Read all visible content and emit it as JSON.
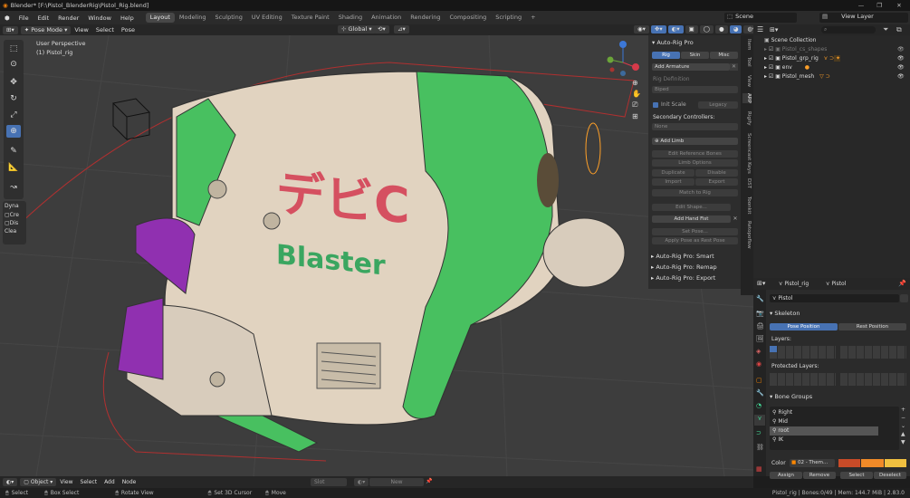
{
  "window": {
    "title": "Blender* [F:\\Pistol_BlenderRig\\Pistol_Rig.blend]",
    "controls": [
      "—",
      "❐",
      "✕"
    ]
  },
  "menubar": {
    "items": [
      "File",
      "Edit",
      "Render",
      "Window",
      "Help"
    ]
  },
  "workspaces": [
    "Layout",
    "Modeling",
    "Sculpting",
    "UV Editing",
    "Texture Paint",
    "Shading",
    "Animation",
    "Rendering",
    "Compositing",
    "Scripting",
    "+"
  ],
  "scene": {
    "label": "Scene",
    "view_layer": "View Layer"
  },
  "viewport_header": {
    "mode": "Pose Mode",
    "menus": [
      "View",
      "Select",
      "Pose"
    ],
    "transform": "Global"
  },
  "viewport": {
    "perspective": "User Perspective",
    "object": "(1) Pistol_rig",
    "logo_text": "Blaster",
    "logo_glyphs": "デビC"
  },
  "toolbar_dyn": {
    "title": "Dyna",
    "items": [
      "Cre",
      "Dis",
      "Clea"
    ]
  },
  "npanel": {
    "title": "Auto-Rig Pro",
    "tabs": [
      "Rig",
      "Skin",
      "Misc"
    ],
    "add_armature": "Add Armature",
    "rig_definition": "Rig Definition",
    "rig_definition_value": "Biped",
    "init_scale": "Init Scale",
    "legacy": "Legacy",
    "secondary": "Secondary Controllers:",
    "secondary_value": "None",
    "add_limb": "Add Limb",
    "edit_reference": "Edit Reference Bones",
    "limb_options": "Limb Options",
    "duplicate": "Duplicate",
    "disable": "Disable",
    "import": "Import",
    "export": "Export",
    "match_to_rig": "Match to Rig",
    "edit_shape": "Edit Shape...",
    "add_hand_fist": "Add Hand Fist",
    "set_pose": "Set Pose...",
    "apply_pose": "Apply Pose as Rest Pose",
    "sub_panels": [
      "Auto-Rig Pro: Smart",
      "Auto-Rig Pro: Remap",
      "Auto-Rig Pro: Export"
    ],
    "side_tabs": [
      "Item",
      "Tool",
      "View",
      "ARP",
      "Rigify",
      "Screencast Keys",
      "DST",
      "Toonkit",
      "Retopoflow"
    ]
  },
  "outliner": {
    "root": "Scene Collection",
    "items": [
      {
        "name": "Pistol_cs_shapes",
        "dim": true
      },
      {
        "name": "Pistol_grp_rig",
        "dim": false
      },
      {
        "name": "env",
        "dim": false
      },
      {
        "name": "Pistol_mesh",
        "dim": false
      }
    ]
  },
  "properties": {
    "armature": "Pistol_rig",
    "data": "Pistol",
    "data_field": "Pistol",
    "skeleton": "Skeleton",
    "pose_position": "Pose Position",
    "rest_position": "Rest Position",
    "layers": "Layers:",
    "protected_layers": "Protected Layers:",
    "bone_groups": "Bone Groups",
    "groups": [
      "Right",
      "Mid",
      "root",
      "IK"
    ],
    "selected_group": "root",
    "color_label": "Color",
    "color_set": "02 - Them...",
    "assign": "Assign",
    "remove": "Remove",
    "select": "Select",
    "deselect": "Deselect"
  },
  "timeline": {
    "mode": "Object",
    "menus": [
      "View",
      "Select",
      "Add",
      "Node"
    ],
    "slot": "Slot",
    "new": "New"
  },
  "status": {
    "left": [
      "Select",
      "Box Select",
      "Rotate View",
      "Set 3D Cursor",
      "Move"
    ],
    "right": "Pistol_rig | Bones:0/49 | Mem: 144.7 MiB | 2.83.0"
  },
  "colors": {
    "accent": "#4772b3",
    "active_outline": "#ffa028",
    "body": "#e1d3c0",
    "green": "#48c060",
    "purple": "#9030b0",
    "logo_red": "#d55060",
    "logo_green": "#3aa660"
  }
}
